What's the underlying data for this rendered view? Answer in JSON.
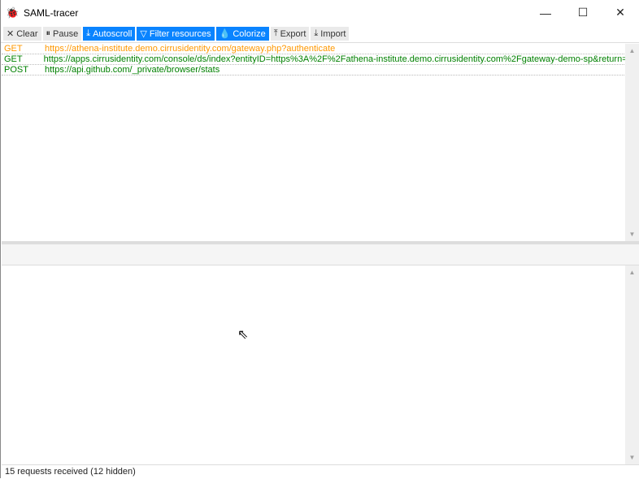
{
  "window": {
    "title": "SAML-tracer",
    "minimize": "—",
    "maximize": "☐",
    "close": "✕"
  },
  "toolbar": [
    {
      "label": "Clear",
      "icon": "✕",
      "active": false,
      "name": "clear"
    },
    {
      "label": "Pause",
      "icon": "⏸",
      "active": false,
      "name": "pause"
    },
    {
      "label": "Autoscroll",
      "icon": "⤓",
      "active": true,
      "name": "autoscroll"
    },
    {
      "label": "Filter resources",
      "icon": "▽",
      "active": true,
      "name": "filter-resources"
    },
    {
      "label": "Colorize",
      "icon": "💧",
      "active": true,
      "name": "colorize"
    },
    {
      "label": "Export",
      "icon": "⤒",
      "active": false,
      "name": "export"
    },
    {
      "label": "Import",
      "icon": "⤓",
      "active": false,
      "name": "import"
    }
  ],
  "requests": [
    {
      "method": "GET",
      "url": "https://athena-institute.demo.cirrusidentity.com/gateway.php?authenticate",
      "color": "orange"
    },
    {
      "method": "GET",
      "url": "https://apps.cirrusidentity.com/console/ds/index?entityID=https%3A%2F%2Fathena-institute.demo.cirrusidentity.com%2Fgateway-demo-sp&return=http",
      "color": "green"
    },
    {
      "method": "POST",
      "url": "https://api.github.com/_private/browser/stats",
      "color": "green"
    }
  ],
  "status": "15 requests received (12 hidden)"
}
